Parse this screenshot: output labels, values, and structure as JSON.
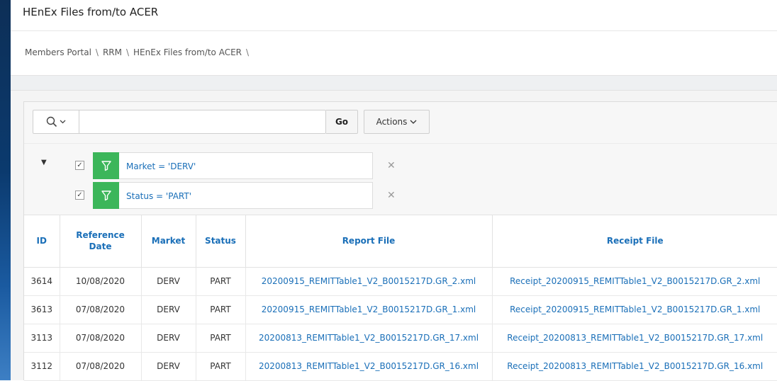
{
  "page": {
    "title": "HEnEx Files from/to ACER"
  },
  "breadcrumb": [
    "Members Portal",
    "RRM",
    "HEnEx Files from/to ACER"
  ],
  "breadcrumb_separator": "\\",
  "toolbar": {
    "search_placeholder": "",
    "search_value": "",
    "search_icon": "search-icon",
    "go_label": "Go",
    "actions_label": "Actions"
  },
  "filters": [
    {
      "text": "Market = 'DERV'",
      "checked": true
    },
    {
      "text": "Status = 'PART'",
      "checked": true
    }
  ],
  "table": {
    "headers": {
      "id": "ID",
      "reference_date_line1": "Reference",
      "reference_date_line2": "Date",
      "market": "Market",
      "status": "Status",
      "report_file": "Report File",
      "receipt_file": "Receipt File"
    },
    "rows": [
      {
        "id": "3614",
        "reference_date": "10/08/2020",
        "market": "DERV",
        "status": "PART",
        "report_file": "20200915_REMITTable1_V2_B0015217D.GR_2.xml",
        "receipt_file": "Receipt_20200915_REMITTable1_V2_B0015217D.GR_2.xml"
      },
      {
        "id": "3613",
        "reference_date": "07/08/2020",
        "market": "DERV",
        "status": "PART",
        "report_file": "20200915_REMITTable1_V2_B0015217D.GR_1.xml",
        "receipt_file": "Receipt_20200915_REMITTable1_V2_B0015217D.GR_1.xml"
      },
      {
        "id": "3113",
        "reference_date": "07/08/2020",
        "market": "DERV",
        "status": "PART",
        "report_file": "20200813_REMITTable1_V2_B0015217D.GR_17.xml",
        "receipt_file": "Receipt_20200813_REMITTable1_V2_B0015217D.GR_17.xml"
      },
      {
        "id": "3112",
        "reference_date": "07/08/2020",
        "market": "DERV",
        "status": "PART",
        "report_file": "20200813_REMITTable1_V2_B0015217D.GR_16.xml",
        "receipt_file": "Receipt_20200813_REMITTable1_V2_B0015217D.GR_16.xml"
      }
    ]
  },
  "colors": {
    "link": "#1a6fb8",
    "filter_badge": "#3cb65a",
    "side_strip": "#0b3a6e"
  }
}
